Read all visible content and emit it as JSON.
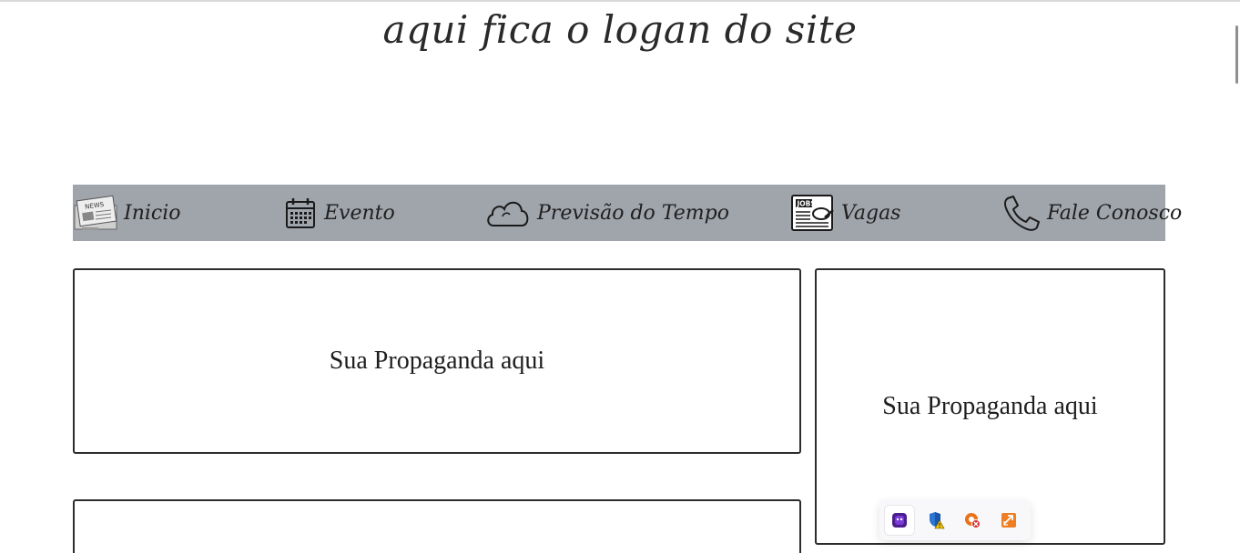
{
  "site": {
    "logo_text": "aqui fica o logan do site"
  },
  "nav": {
    "items": [
      {
        "label": "Inicio",
        "icon": "newspaper-icon"
      },
      {
        "label": "Evento",
        "icon": "calendar-icon"
      },
      {
        "label": "Previsão do Tempo",
        "icon": "cloud-icon"
      },
      {
        "label": "Vagas",
        "icon": "jobs-newspaper-icon"
      },
      {
        "label": "Fale Conosco",
        "icon": "phone-icon"
      }
    ],
    "background_color": "#a0a4ab"
  },
  "ads": {
    "main_text": "Sua Propaganda aqui",
    "side_text": "Sua Propaganda aqui",
    "lower_text": ""
  },
  "tray": {
    "icons": [
      "purple-app-icon",
      "shield-warning-icon",
      "blocked-icon",
      "orange-extension-icon"
    ]
  }
}
